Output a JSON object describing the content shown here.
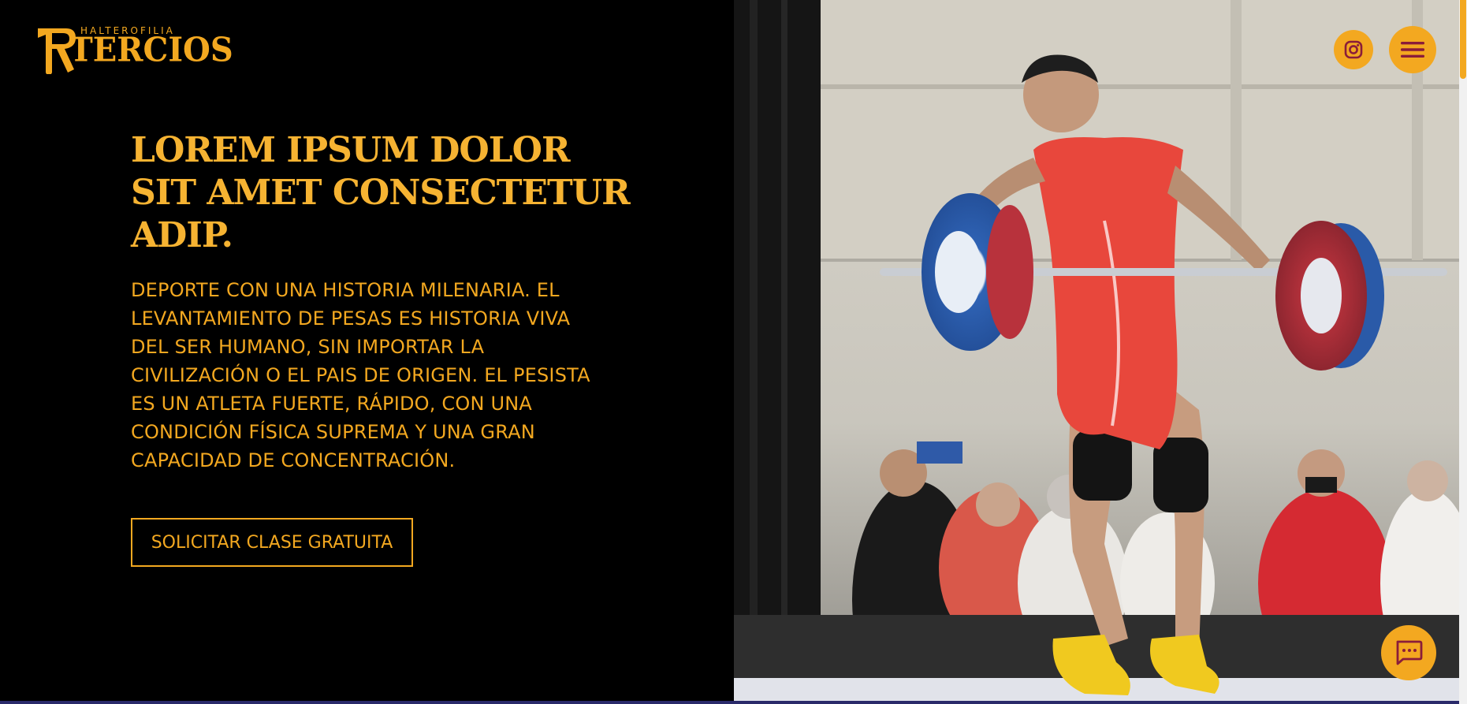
{
  "brand": {
    "small_text": "HALTEROFILIA",
    "main_text": "TERCIOS",
    "color": "#f3a820"
  },
  "hero": {
    "headline": "LOREM IPSUM DOLOR SIT AMET CONSECTETUR ADIP.",
    "description": "DEPORTE CON UNA HISTORIA MILENARIA. EL LEVANTAMIENTO DE PESAS ES HISTORIA VIVA DEL SER HUMANO, SIN IMPORTAR LA CIVILIZACIÓN O EL PAIS DE ORIGEN. EL PESISTA ES UN ATLETA FUERTE, RÁPIDO, CON UNA CONDICIÓN FÍSICA SUPREMA Y UNA GRAN CAPACIDAD DE CONCENTRACIÓN.",
    "cta_label": "SOLICITAR CLASE GRATUITA"
  },
  "header": {
    "social_icon": "instagram-icon",
    "menu_icon": "hamburger-menu-icon"
  },
  "chat": {
    "icon": "chat-bubble-icon"
  },
  "carousel": {
    "slide_count": 3,
    "active_index": 0
  },
  "colors": {
    "accent": "#f3a820",
    "background": "#000000",
    "singlet_red": "#e8473c",
    "plate_blue": "#2f63b5",
    "plate_red": "#b8323c"
  }
}
